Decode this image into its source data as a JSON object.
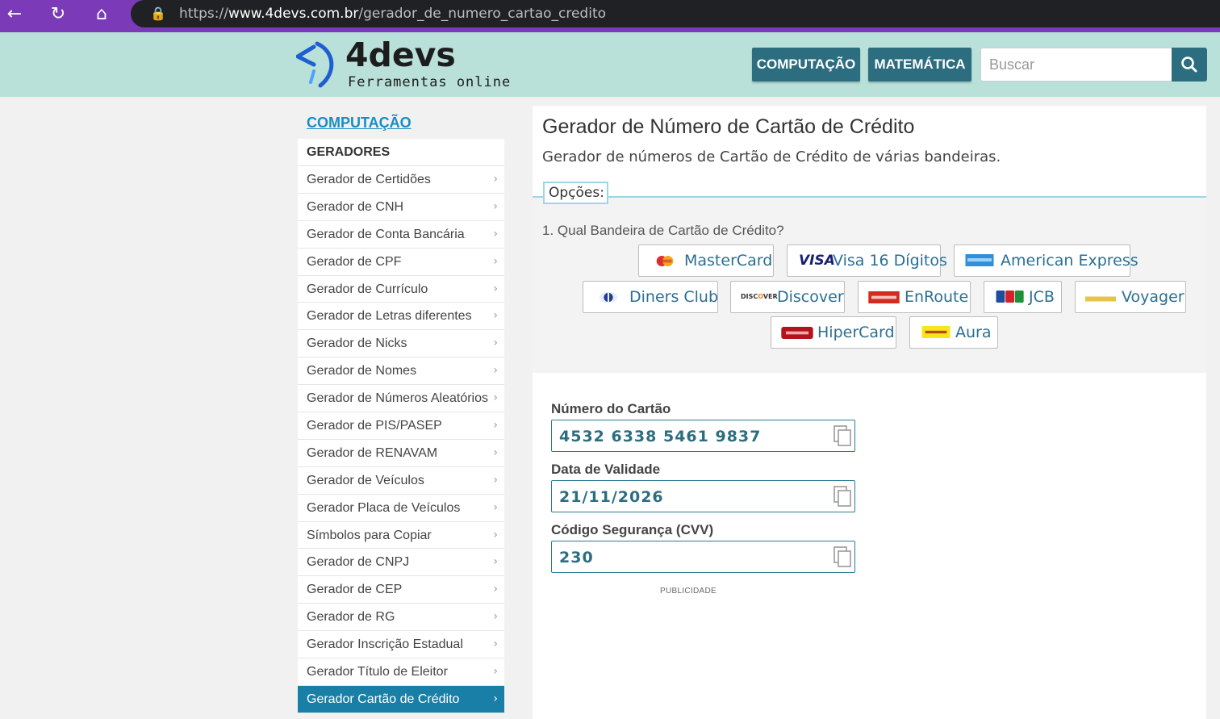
{
  "browser": {
    "url_scheme": "https://",
    "url_host": "www.4devs.com.br",
    "url_path": "/gerador_de_numero_cartao_credito"
  },
  "header": {
    "logo_name": "4devs",
    "logo_tagline": "Ferramentas online",
    "nav": [
      "COMPUTAÇÃO",
      "MATEMÁTICA"
    ],
    "search_placeholder": "Buscar"
  },
  "sidebar": {
    "category": "COMPUTAÇÃO",
    "section": "GERADORES",
    "items": [
      "Gerador de Certidões",
      "Gerador de CNH",
      "Gerador de Conta Bancária",
      "Gerador de CPF",
      "Gerador de Currículo",
      "Gerador de Letras diferentes",
      "Gerador de Nicks",
      "Gerador de Nomes",
      "Gerador de Números Aleatórios",
      "Gerador de PIS/PASEP",
      "Gerador de RENAVAM",
      "Gerador de Veículos",
      "Gerador Placa de Veículos",
      "Símbolos para Copiar",
      "Gerador de CNPJ",
      "Gerador de CEP",
      "Gerador de RG",
      "Gerador Inscrição Estadual",
      "Gerador Título de Eleitor",
      "Gerador Cartão de Crédito"
    ],
    "active_item": "Gerador Cartão de Crédito"
  },
  "main": {
    "title": "Gerador de Número de Cartão de Crédito",
    "subtitle": "Gerador de números de Cartão de Crédito de várias bandeiras.",
    "options_tab": "Opções:",
    "question": "1. Qual Bandeira de Cartão de Crédito?",
    "brands": [
      {
        "label": "MasterCard",
        "icon": "mastercard-icon"
      },
      {
        "label": "Visa 16 Dígitos",
        "icon": "visa-icon"
      },
      {
        "label": "American Express",
        "icon": "amex-icon"
      },
      {
        "label": "Diners Club",
        "icon": "diners-icon"
      },
      {
        "label": "Discover",
        "icon": "discover-icon"
      },
      {
        "label": "EnRoute",
        "icon": "enroute-icon"
      },
      {
        "label": "JCB",
        "icon": "jcb-icon"
      },
      {
        "label": "Voyager",
        "icon": "voyager-icon"
      },
      {
        "label": "HiperCard",
        "icon": "hipercard-icon"
      },
      {
        "label": "Aura",
        "icon": "aura-icon"
      }
    ],
    "fields": [
      {
        "label": "Número do Cartão",
        "value": "4532 6338 5461 9837"
      },
      {
        "label": "Data de Validade",
        "value": "21/11/2026"
      },
      {
        "label": "Código Segurança (CVV)",
        "value": "230"
      }
    ],
    "ad_label": "PUBLICIDADE"
  },
  "colors": {
    "browser_accent": "#7b3bb8",
    "header_bg": "#b9e0d9",
    "primary": "#2c6e80",
    "link": "#1a8cc4",
    "active_item": "#1a7fa6"
  }
}
